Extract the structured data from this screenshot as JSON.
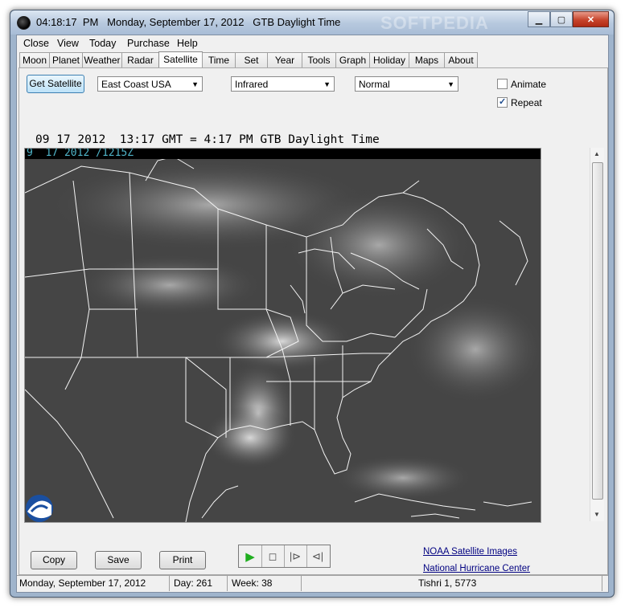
{
  "window": {
    "title": "04:18:17  PM   Monday, September 17, 2012   GTB Daylight Time",
    "watermark": "SOFTPEDIA"
  },
  "menu": [
    "Close",
    "View",
    "Today",
    "Purchase",
    "Help"
  ],
  "tabs": [
    "Moon",
    "Planet",
    "Weather",
    "Radar",
    "Satellite",
    "Time",
    "Set",
    "Year",
    "Tools",
    "Graph",
    "Holiday",
    "Maps",
    "About"
  ],
  "active_tab": "Satellite",
  "controls": {
    "get_satellite": "Get Satellite",
    "region": "East Coast USA",
    "channel": "Infrared",
    "mode": "Normal",
    "animate_label": "Animate",
    "animate_checked": false,
    "repeat_label": "Repeat",
    "repeat_checked": true
  },
  "time_line": "09 17 2012  13:17 GMT = 4:17 PM GTB Daylight Time",
  "image_stamp": "9  17 2012 /1215Z",
  "buttons": {
    "copy": "Copy",
    "save": "Save",
    "print": "Print"
  },
  "links": {
    "noaa": "NOAA Satellite Images",
    "nhc": "National Hurricane Center"
  },
  "status": {
    "date": "Monday, September 17, 2012",
    "day": "Day: 261",
    "week": "Week: 38",
    "hebrew": "Tishri 1, 5773"
  },
  "colors": {
    "play": "#1fae1f",
    "link": "#000080",
    "stamp": "#4fb4c8"
  }
}
